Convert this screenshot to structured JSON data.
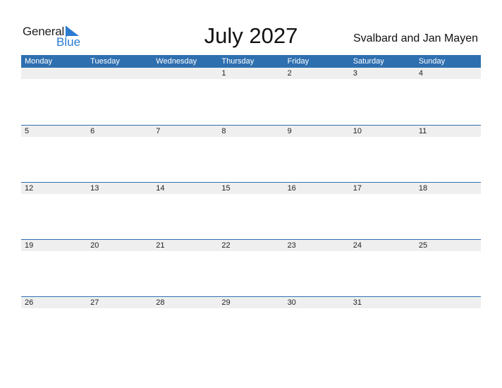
{
  "logo": {
    "general": "General",
    "blue": "Blue"
  },
  "title": "July 2027",
  "region": "Svalbard and Jan Mayen",
  "weekdays": [
    "Monday",
    "Tuesday",
    "Wednesday",
    "Thursday",
    "Friday",
    "Saturday",
    "Sunday"
  ],
  "weeks": [
    [
      "",
      "",
      "",
      "1",
      "2",
      "3",
      "4"
    ],
    [
      "5",
      "6",
      "7",
      "8",
      "9",
      "10",
      "11"
    ],
    [
      "12",
      "13",
      "14",
      "15",
      "16",
      "17",
      "18"
    ],
    [
      "19",
      "20",
      "21",
      "22",
      "23",
      "24",
      "25"
    ],
    [
      "26",
      "27",
      "28",
      "29",
      "30",
      "31",
      ""
    ]
  ],
  "colors": {
    "header": "#2e6fb0",
    "brand_blue": "#2a7bd0",
    "row_bg": "#efefef"
  }
}
